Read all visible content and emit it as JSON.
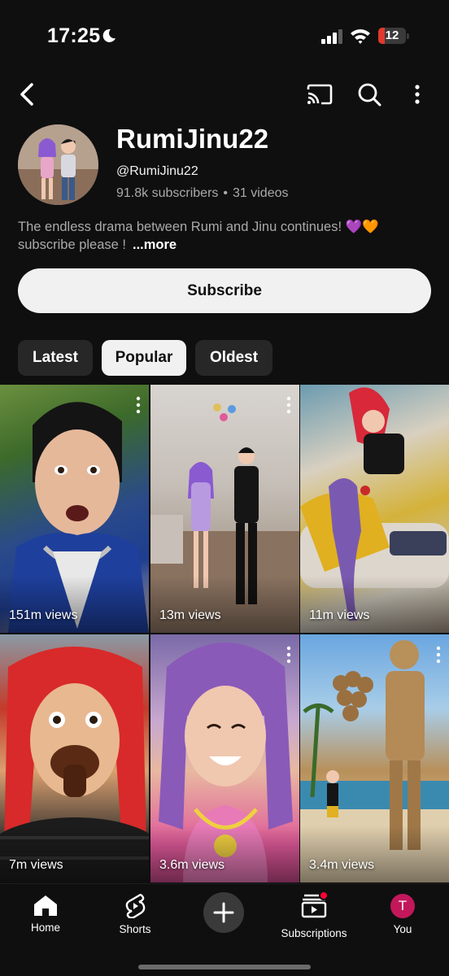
{
  "status_bar": {
    "time": "17:25",
    "battery": "12",
    "icons": [
      "moon-icon",
      "signal-icon",
      "wifi-icon",
      "battery-icon"
    ]
  },
  "top_nav": {
    "icons": [
      "back-arrow-icon",
      "cast-icon",
      "search-icon",
      "more-vertical-icon"
    ]
  },
  "channel": {
    "name": "RumiJinu22",
    "handle": "@RumiJinu22",
    "subscribers": "91.8k subscribers",
    "separator": "•",
    "videos": "31 videos",
    "description": "The endless drama between Rumi and Jinu continues! 💜🧡 subscribe please !",
    "more_label": "...more",
    "subscribe_label": "Subscribe"
  },
  "filters": {
    "chips": [
      {
        "label": "Latest",
        "active": false
      },
      {
        "label": "Popular",
        "active": true
      },
      {
        "label": "Oldest",
        "active": false
      }
    ]
  },
  "videos": [
    {
      "views": "151m views"
    },
    {
      "views": "13m views"
    },
    {
      "views": "11m views"
    },
    {
      "views": "7m views"
    },
    {
      "views": "3.6m views"
    },
    {
      "views": "3.4m views"
    }
  ],
  "bottom_nav": {
    "home": "Home",
    "shorts": "Shorts",
    "subscriptions": "Subscriptions",
    "you": "You",
    "you_initial": "T"
  },
  "colors": {
    "background": "#0f0f0f",
    "chip_bg": "#272727",
    "active_chip": "#f1f1f1",
    "secondary_text": "#aaaaaa",
    "battery_low": "#e0392d",
    "notification_dot": "#ff0033",
    "you_avatar": "#c2185b"
  }
}
